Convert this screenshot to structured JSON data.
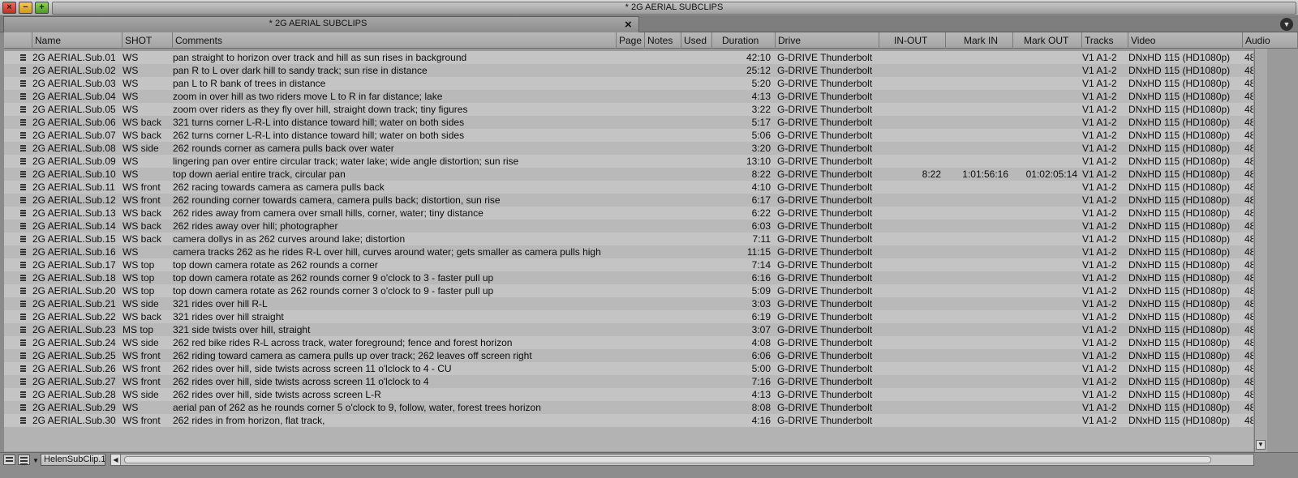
{
  "window": {
    "title": "* 2G AERIAL SUBCLIPS",
    "close_glyph": "×",
    "minimize_glyph": "−",
    "maximize_glyph": "+"
  },
  "tab": {
    "label": "* 2G AERIAL SUBCLIPS",
    "close_glyph": "×",
    "menu_glyph": "▼"
  },
  "columns": [
    "Name",
    "SHOT",
    "Comments",
    "Page",
    "Notes",
    "Used",
    "Duration",
    "Drive",
    "IN-OUT",
    "Mark IN",
    "Mark OUT",
    "Tracks",
    "Video",
    "Audio"
  ],
  "rows": [
    {
      "name": "2G AERIAL.Sub.01",
      "shot": "WS",
      "comments": "pan straight to horizon over track and hill as sun rises in background",
      "duration": "42:10",
      "drive": "G-DRIVE Thunderbolt",
      "in_out": "",
      "mark_in": "",
      "mark_out": "",
      "tracks": "V1 A1-2",
      "video": "DNxHD 115 (HD1080p)",
      "audio": "48"
    },
    {
      "name": "2G AERIAL.Sub.02",
      "shot": "WS",
      "comments": "pan R to L over dark hill to sandy track; sun rise in distance",
      "duration": "25:12",
      "drive": "G-DRIVE Thunderbolt",
      "in_out": "",
      "mark_in": "",
      "mark_out": "",
      "tracks": "V1 A1-2",
      "video": "DNxHD 115 (HD1080p)",
      "audio": "48"
    },
    {
      "name": "2G AERIAL.Sub.03",
      "shot": "WS",
      "comments": "pan L to R bank of trees in distance",
      "duration": "5:20",
      "drive": "G-DRIVE Thunderbolt",
      "in_out": "",
      "mark_in": "",
      "mark_out": "",
      "tracks": "V1 A1-2",
      "video": "DNxHD 115 (HD1080p)",
      "audio": "48"
    },
    {
      "name": "2G AERIAL.Sub.04",
      "shot": "WS",
      "comments": "zoom in over hill as two riders move L to R in far distance; lake",
      "duration": "4:13",
      "drive": "G-DRIVE Thunderbolt",
      "in_out": "",
      "mark_in": "",
      "mark_out": "",
      "tracks": "V1 A1-2",
      "video": "DNxHD 115 (HD1080p)",
      "audio": "48"
    },
    {
      "name": "2G AERIAL.Sub.05",
      "shot": "WS",
      "comments": "zoom over riders as they fly over hill, straight down track; tiny figures",
      "duration": "3:22",
      "drive": "G-DRIVE Thunderbolt",
      "in_out": "",
      "mark_in": "",
      "mark_out": "",
      "tracks": "V1 A1-2",
      "video": "DNxHD 115 (HD1080p)",
      "audio": "48"
    },
    {
      "name": "2G AERIAL.Sub.06",
      "shot": "WS back",
      "comments": "321 turns corner L-R-L into distance toward hill; water on both sides",
      "duration": "5:17",
      "drive": "G-DRIVE Thunderbolt",
      "in_out": "",
      "mark_in": "",
      "mark_out": "",
      "tracks": "V1 A1-2",
      "video": "DNxHD 115 (HD1080p)",
      "audio": "48"
    },
    {
      "name": "2G AERIAL.Sub.07",
      "shot": "WS back",
      "comments": "262 turns corner L-R-L into distance toward hill; water on both sides",
      "duration": "5:06",
      "drive": "G-DRIVE Thunderbolt",
      "in_out": "",
      "mark_in": "",
      "mark_out": "",
      "tracks": "V1 A1-2",
      "video": "DNxHD 115 (HD1080p)",
      "audio": "48"
    },
    {
      "name": "2G AERIAL.Sub.08",
      "shot": "WS side",
      "comments": "262 rounds corner as camera pulls back over water",
      "duration": "3:20",
      "drive": "G-DRIVE Thunderbolt",
      "in_out": "",
      "mark_in": "",
      "mark_out": "",
      "tracks": "V1 A1-2",
      "video": "DNxHD 115 (HD1080p)",
      "audio": "48"
    },
    {
      "name": "2G AERIAL.Sub.09",
      "shot": "WS",
      "comments": "lingering pan over entire circular track; water lake; wide angle distortion; sun rise",
      "duration": "13:10",
      "drive": "G-DRIVE Thunderbolt",
      "in_out": "",
      "mark_in": "",
      "mark_out": "",
      "tracks": "V1 A1-2",
      "video": "DNxHD 115 (HD1080p)",
      "audio": "48"
    },
    {
      "name": "2G AERIAL.Sub.10",
      "shot": "WS",
      "comments": "top down aerial entire track, circular pan",
      "duration": "8:22",
      "drive": "G-DRIVE Thunderbolt",
      "in_out": "8:22",
      "mark_in": "1:01:56:16",
      "mark_out": "01:02:05:14",
      "tracks": "V1 A1-2",
      "video": "DNxHD 115 (HD1080p)",
      "audio": "48"
    },
    {
      "name": "2G AERIAL.Sub.11",
      "shot": "WS front",
      "comments": "262 racing towards camera as camera pulls back",
      "duration": "4:10",
      "drive": "G-DRIVE Thunderbolt",
      "in_out": "",
      "mark_in": "",
      "mark_out": "",
      "tracks": "V1 A1-2",
      "video": "DNxHD 115 (HD1080p)",
      "audio": "48"
    },
    {
      "name": "2G AERIAL.Sub.12",
      "shot": "WS front",
      "comments": "262 rounding corner towards camera, camera pulls back; distortion, sun rise",
      "duration": "6:17",
      "drive": "G-DRIVE Thunderbolt",
      "in_out": "",
      "mark_in": "",
      "mark_out": "",
      "tracks": "V1 A1-2",
      "video": "DNxHD 115 (HD1080p)",
      "audio": "48"
    },
    {
      "name": "2G AERIAL.Sub.13",
      "shot": "WS back",
      "comments": "262 rides away from camera over small hills, corner, water; tiny distance",
      "duration": "6:22",
      "drive": "G-DRIVE Thunderbolt",
      "in_out": "",
      "mark_in": "",
      "mark_out": "",
      "tracks": "V1 A1-2",
      "video": "DNxHD 115 (HD1080p)",
      "audio": "48"
    },
    {
      "name": "2G AERIAL.Sub.14",
      "shot": "WS back",
      "comments": "262 rides away over hill; photographer",
      "duration": "6:03",
      "drive": "G-DRIVE Thunderbolt",
      "in_out": "",
      "mark_in": "",
      "mark_out": "",
      "tracks": "V1 A1-2",
      "video": "DNxHD 115 (HD1080p)",
      "audio": "48"
    },
    {
      "name": "2G AERIAL.Sub.15",
      "shot": "WS back",
      "comments": "camera dollys in as 262 curves around lake; distortion",
      "duration": "7:11",
      "drive": "G-DRIVE Thunderbolt",
      "in_out": "",
      "mark_in": "",
      "mark_out": "",
      "tracks": "V1 A1-2",
      "video": "DNxHD 115 (HD1080p)",
      "audio": "48"
    },
    {
      "name": "2G AERIAL.Sub.16",
      "shot": "WS",
      "comments": "camera tracks 262 as he rides R-L over hill, curves around water; gets smaller as camera pulls high",
      "duration": "11:15",
      "drive": "G-DRIVE Thunderbolt",
      "in_out": "",
      "mark_in": "",
      "mark_out": "",
      "tracks": "V1 A1-2",
      "video": "DNxHD 115 (HD1080p)",
      "audio": "48"
    },
    {
      "name": "2G AERIAL.Sub.17",
      "shot": "WS top",
      "comments": "top down camera rotate as 262 rounds a corner",
      "duration": "7:14",
      "drive": "G-DRIVE Thunderbolt",
      "in_out": "",
      "mark_in": "",
      "mark_out": "",
      "tracks": "V1 A1-2",
      "video": "DNxHD 115 (HD1080p)",
      "audio": "48"
    },
    {
      "name": "2G AERIAL.Sub.18",
      "shot": "WS top",
      "comments": "top down camera rotate as 262 rounds corner 9 o'clock to 3 - faster pull up",
      "duration": "6:16",
      "drive": "G-DRIVE Thunderbolt",
      "in_out": "",
      "mark_in": "",
      "mark_out": "",
      "tracks": "V1 A1-2",
      "video": "DNxHD 115 (HD1080p)",
      "audio": "48"
    },
    {
      "name": "2G AERIAL.Sub.20",
      "shot": "WS top",
      "comments": "top down camera rotate as 262 rounds corner 3 o'clock to 9 - faster pull up",
      "duration": "5:09",
      "drive": "G-DRIVE Thunderbolt",
      "in_out": "",
      "mark_in": "",
      "mark_out": "",
      "tracks": "V1 A1-2",
      "video": "DNxHD 115 (HD1080p)",
      "audio": "48"
    },
    {
      "name": "2G AERIAL.Sub.21",
      "shot": "WS side",
      "comments": "321 rides over hill R-L",
      "duration": "3:03",
      "drive": "G-DRIVE Thunderbolt",
      "in_out": "",
      "mark_in": "",
      "mark_out": "",
      "tracks": "V1 A1-2",
      "video": "DNxHD 115 (HD1080p)",
      "audio": "48"
    },
    {
      "name": "2G AERIAL.Sub.22",
      "shot": "WS back",
      "comments": "321 rides over hill straight",
      "duration": "6:19",
      "drive": "G-DRIVE Thunderbolt",
      "in_out": "",
      "mark_in": "",
      "mark_out": "",
      "tracks": "V1 A1-2",
      "video": "DNxHD 115 (HD1080p)",
      "audio": "48"
    },
    {
      "name": "2G AERIAL.Sub.23",
      "shot": "MS top",
      "comments": "321 side twists over hill, straight",
      "duration": "3:07",
      "drive": "G-DRIVE Thunderbolt",
      "in_out": "",
      "mark_in": "",
      "mark_out": "",
      "tracks": "V1 A1-2",
      "video": "DNxHD 115 (HD1080p)",
      "audio": "48"
    },
    {
      "name": "2G AERIAL.Sub.24",
      "shot": "WS side",
      "comments": "262 red bike rides R-L across track, water foreground; fence and forest horizon",
      "duration": "4:08",
      "drive": "G-DRIVE Thunderbolt",
      "in_out": "",
      "mark_in": "",
      "mark_out": "",
      "tracks": "V1 A1-2",
      "video": "DNxHD 115 (HD1080p)",
      "audio": "48"
    },
    {
      "name": "2G AERIAL.Sub.25",
      "shot": "WS front",
      "comments": "262 riding toward camera as camera pulls up over track; 262 leaves off screen right",
      "duration": "6:06",
      "drive": "G-DRIVE Thunderbolt",
      "in_out": "",
      "mark_in": "",
      "mark_out": "",
      "tracks": "V1 A1-2",
      "video": "DNxHD 115 (HD1080p)",
      "audio": "48"
    },
    {
      "name": "2G AERIAL.Sub.26",
      "shot": "WS front",
      "comments": "262 rides over hill, side twists across screen 11 o'lclock to 4 - CU",
      "duration": "5:00",
      "drive": "G-DRIVE Thunderbolt",
      "in_out": "",
      "mark_in": "",
      "mark_out": "",
      "tracks": "V1 A1-2",
      "video": "DNxHD 115 (HD1080p)",
      "audio": "48"
    },
    {
      "name": "2G AERIAL.Sub.27",
      "shot": "WS front",
      "comments": "262 rides over hill, side twists across screen 11 o'lclock to 4",
      "duration": "7:16",
      "drive": "G-DRIVE Thunderbolt",
      "in_out": "",
      "mark_in": "",
      "mark_out": "",
      "tracks": "V1 A1-2",
      "video": "DNxHD 115 (HD1080p)",
      "audio": "48"
    },
    {
      "name": "2G AERIAL.Sub.28",
      "shot": "WS side",
      "comments": "262 rides over hill, side twists across screen L-R",
      "duration": "4:13",
      "drive": "G-DRIVE Thunderbolt",
      "in_out": "",
      "mark_in": "",
      "mark_out": "",
      "tracks": "V1 A1-2",
      "video": "DNxHD 115 (HD1080p)",
      "audio": "48"
    },
    {
      "name": "2G AERIAL.Sub.29",
      "shot": "WS",
      "comments": "aerial pan of 262 as he rounds corner 5 o'clock to 9, follow, water, forest trees horizon",
      "duration": "8:08",
      "drive": "G-DRIVE Thunderbolt",
      "in_out": "",
      "mark_in": "",
      "mark_out": "",
      "tracks": "V1 A1-2",
      "video": "DNxHD 115 (HD1080p)",
      "audio": "48"
    },
    {
      "name": "2G AERIAL.Sub.30",
      "shot": "WS front",
      "comments": "262 rides in from horizon, flat track,",
      "duration": "4:16",
      "drive": "G-DRIVE Thunderbolt",
      "in_out": "",
      "mark_in": "",
      "mark_out": "",
      "tracks": "V1 A1-2",
      "video": "DNxHD 115 (HD1080p)",
      "audio": "48"
    }
  ],
  "bottom_bar": {
    "view_selector": "HelenSubClip.1",
    "menu_glyph": "▼",
    "scroll_left_glyph": "◀",
    "scroll_down_glyph": "▼"
  },
  "icons": {
    "clip": "subclip-icon",
    "frame_view": "frame-view-icon",
    "text_view": "text-view-icon"
  }
}
